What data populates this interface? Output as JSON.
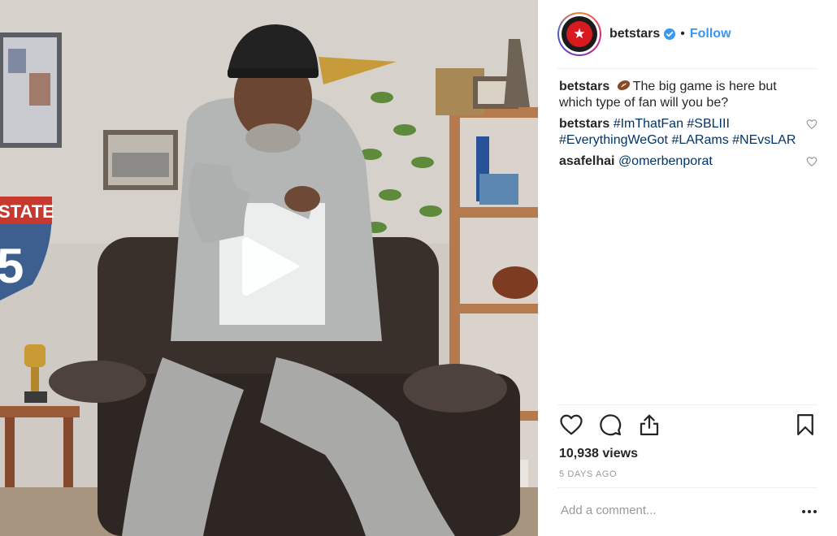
{
  "post": {
    "username": "betstars",
    "follow_label": "Follow",
    "separator": "•",
    "caption": {
      "username": "betstars",
      "emoji": "football-emoji",
      "text": "The big game is here but which type of fan will you be?"
    },
    "comments": [
      {
        "username": "betstars",
        "text": "#ImThatFan #SBLIII #EverythingWeGot #LARams #NEvsLAR"
      },
      {
        "username": "asafelhai",
        "text": "@omerbenporat"
      }
    ],
    "views": "10,938 views",
    "time_ago": "5 DAYS AGO",
    "add_comment_placeholder": "Add a comment...",
    "sign_text": "STATE",
    "sign_number": "5"
  },
  "icons": {
    "verified": "verified-badge-icon",
    "like": "heart-icon",
    "comment": "comment-bubble-icon",
    "share": "share-icon",
    "save": "bookmark-icon",
    "more": "more-options-icon",
    "play": "play-icon"
  },
  "colors": {
    "link": "#3897f0",
    "hashtag": "#003569",
    "brand_red": "#d71920",
    "muted": "#999999"
  }
}
